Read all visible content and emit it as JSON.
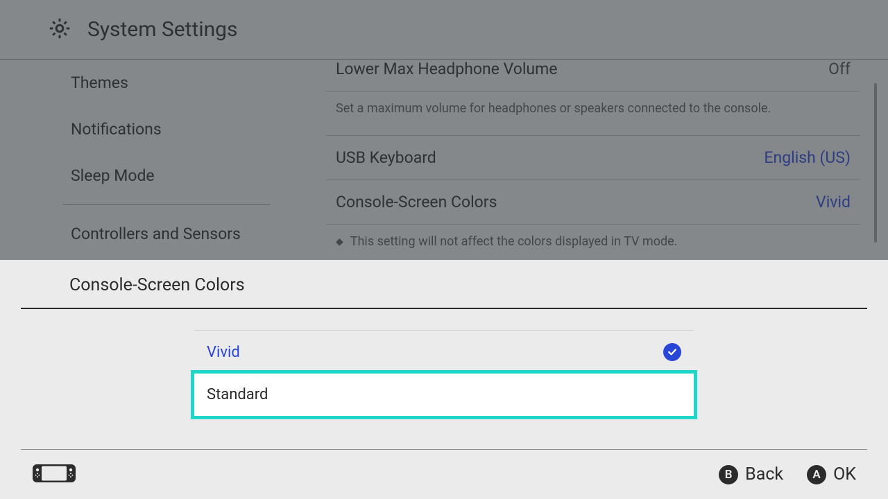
{
  "header": {
    "title": "System Settings"
  },
  "sidebar": {
    "items": [
      "Themes",
      "Notifications",
      "Sleep Mode"
    ],
    "items2": [
      "Controllers and Sensors"
    ]
  },
  "content": {
    "headphone": {
      "label": "Lower Max Headphone Volume",
      "value": "Off"
    },
    "headphone_hint": "Set a maximum volume for headphones or speakers connected to the console.",
    "keyboard": {
      "label": "USB Keyboard",
      "value": "English (US)"
    },
    "colors": {
      "label": "Console-Screen Colors",
      "value": "Vivid"
    },
    "colors_note": "This setting will not affect the colors displayed in TV mode."
  },
  "dialog": {
    "title": "Console-Screen Colors",
    "options": [
      {
        "label": "Vivid",
        "checked": true,
        "focused": false
      },
      {
        "label": "Standard",
        "checked": false,
        "focused": true
      }
    ]
  },
  "footer": {
    "back": "Back",
    "ok": "OK"
  }
}
